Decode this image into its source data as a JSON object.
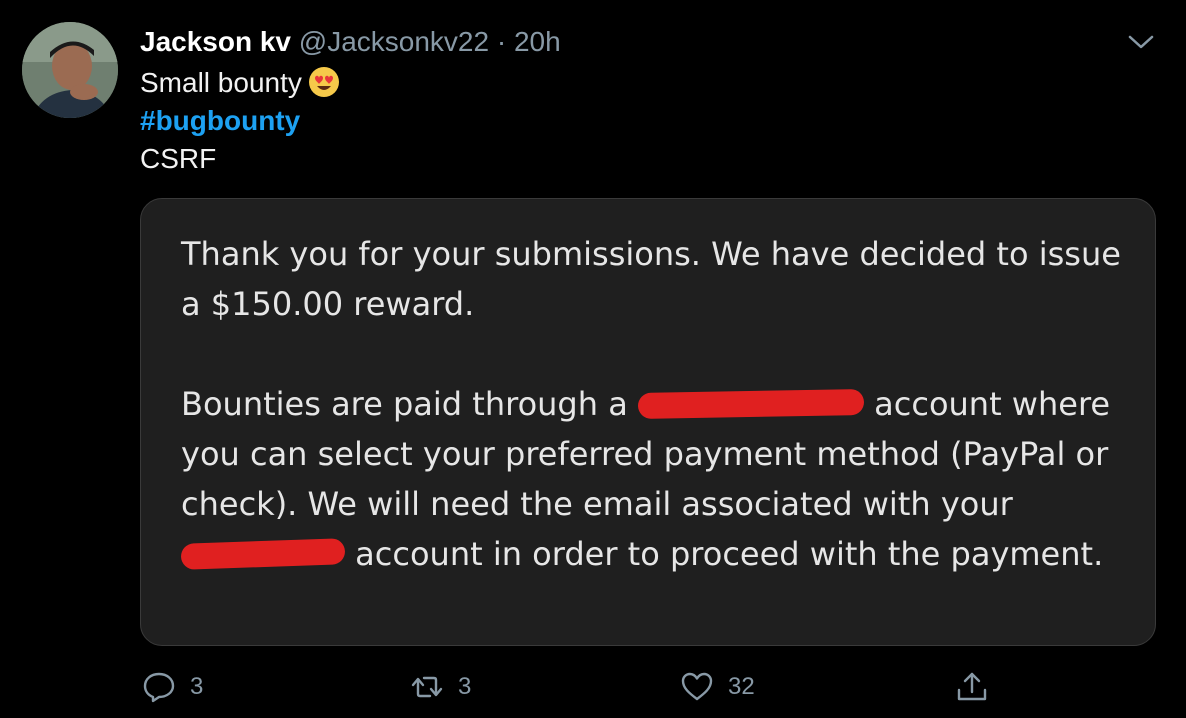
{
  "tweet": {
    "author_name": "Jackson kv",
    "author_handle": "@Jacksonkv22",
    "separator": "·",
    "time": "20h",
    "line1": "Small bounty",
    "hashtag": "#bugbounty",
    "line3": "CSRF"
  },
  "card": {
    "para1": "Thank you for your submissions. We have decided to issue a $150.00 reward.",
    "p2_a": "Bounties are paid through a",
    "p2_b": "account where you can select your preferred payment method (PayPal or check). We will need the email associated with your",
    "p2_c": "account in order to proceed with the payment."
  },
  "actions": {
    "reply_count": "3",
    "retweet_count": "3",
    "like_count": "32"
  },
  "colors": {
    "background": "#000000",
    "hashtag": "#1da1f2",
    "muted": "#8899a6",
    "redaction": "#e02020"
  }
}
